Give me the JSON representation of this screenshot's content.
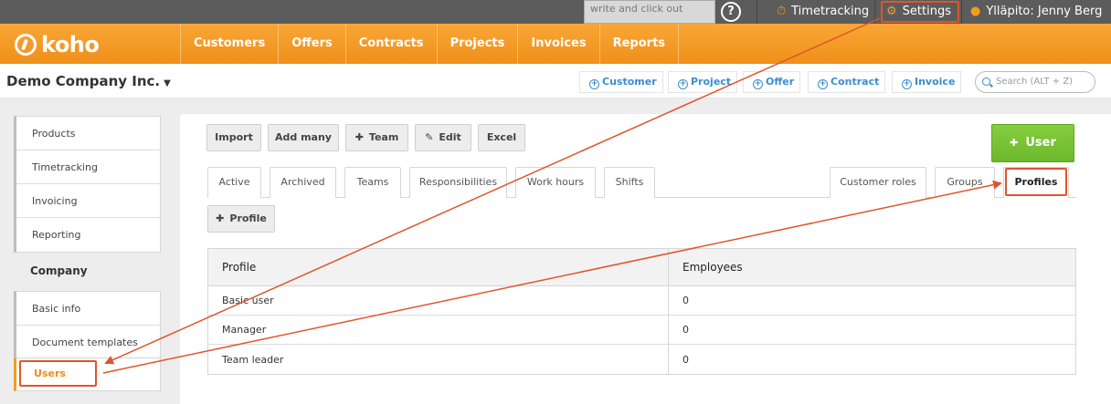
{
  "topbar": {
    "search_value": "write and click out",
    "timetracking_label": "Timetracking",
    "settings_label": "Settings",
    "user_label": "Ylläpito: Jenny Berg"
  },
  "nav": {
    "logo_text": "koho",
    "items": [
      {
        "label": "Customers"
      },
      {
        "label": "Offers"
      },
      {
        "label": "Contracts"
      },
      {
        "label": "Projects"
      },
      {
        "label": "Invoices"
      },
      {
        "label": "Reports"
      }
    ]
  },
  "company": {
    "name": "Demo Company Inc.",
    "quick_add": [
      {
        "label": "Customer"
      },
      {
        "label": "Project"
      },
      {
        "label": "Offer"
      },
      {
        "label": "Contract"
      },
      {
        "label": "Invoice"
      }
    ],
    "search_placeholder": "Search (ALT + Z)"
  },
  "sidebar": {
    "group1": [
      {
        "label": "Products"
      },
      {
        "label": "Timetracking"
      },
      {
        "label": "Invoicing"
      },
      {
        "label": "Reporting"
      }
    ],
    "heading": "Company",
    "group2": [
      {
        "label": "Basic info"
      },
      {
        "label": "Document templates"
      }
    ],
    "active_label": "Users"
  },
  "toolbar": {
    "import_label": "Import",
    "add_many_label": "Add many",
    "team_label": "Team",
    "edit_label": "Edit",
    "excel_label": "Excel",
    "user_label": "User"
  },
  "tabs": {
    "left": [
      {
        "label": "Active"
      },
      {
        "label": "Archived"
      },
      {
        "label": "Teams"
      },
      {
        "label": "Responsibilities"
      },
      {
        "label": "Work hours"
      },
      {
        "label": "Shifts"
      }
    ],
    "right": [
      {
        "label": "Customer roles"
      },
      {
        "label": "Groups"
      },
      {
        "label": "Profiles"
      }
    ]
  },
  "profile_button_label": "Profile",
  "table": {
    "columns": [
      "Profile",
      "Employees"
    ],
    "rows": [
      [
        "Basic user",
        "0"
      ],
      [
        "Manager",
        "0"
      ],
      [
        "Team leader",
        "0"
      ]
    ]
  },
  "colors": {
    "accent_orange": "#f49c1e",
    "annotation_red": "#e0552a",
    "primary_green": "#6cb82d",
    "link_blue": "#3c8dcf"
  }
}
